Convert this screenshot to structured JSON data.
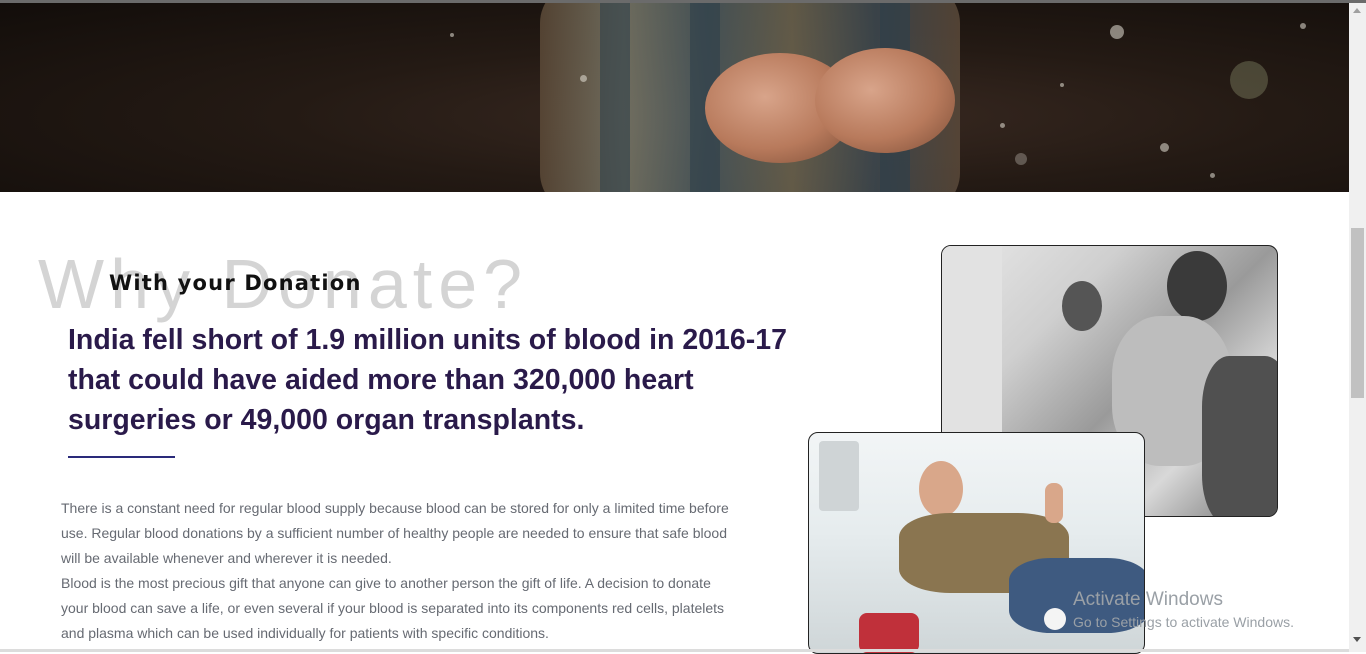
{
  "hero": {
    "alt": "Hands cupped in rain"
  },
  "section": {
    "background_heading": "Why Donate?",
    "subtitle": "With your Donation",
    "headline": "India fell short of 1.9 million units of blood in 2016-17 that could have aided more than 320,000 heart surgeries or 49,000 organ transplants.",
    "paragraphs": [
      "There is a constant need for regular blood supply because blood can be stored for only a limited time before use. Regular blood donations by a sufficient number of healthy people are needed to ensure that safe blood will be available whenever and wherever it is needed.",
      "Blood is the most precious gift that anyone can give to another person the gift of life. A decision to donate your blood can save a life, or even several if your blood is separated into its components red cells, platelets and plasma which can be used individually for patients with specific conditions."
    ]
  },
  "images": {
    "back_photo": "Blood donation black and white photo",
    "front_photo": "Donor giving thumbs up"
  },
  "watermark": {
    "line1": "Activate Windows",
    "line2": "Go to Settings to activate Windows."
  },
  "colors": {
    "headline": "#2a1a4a",
    "accent_rule": "#2a2a7a",
    "body_text": "#666a72"
  }
}
